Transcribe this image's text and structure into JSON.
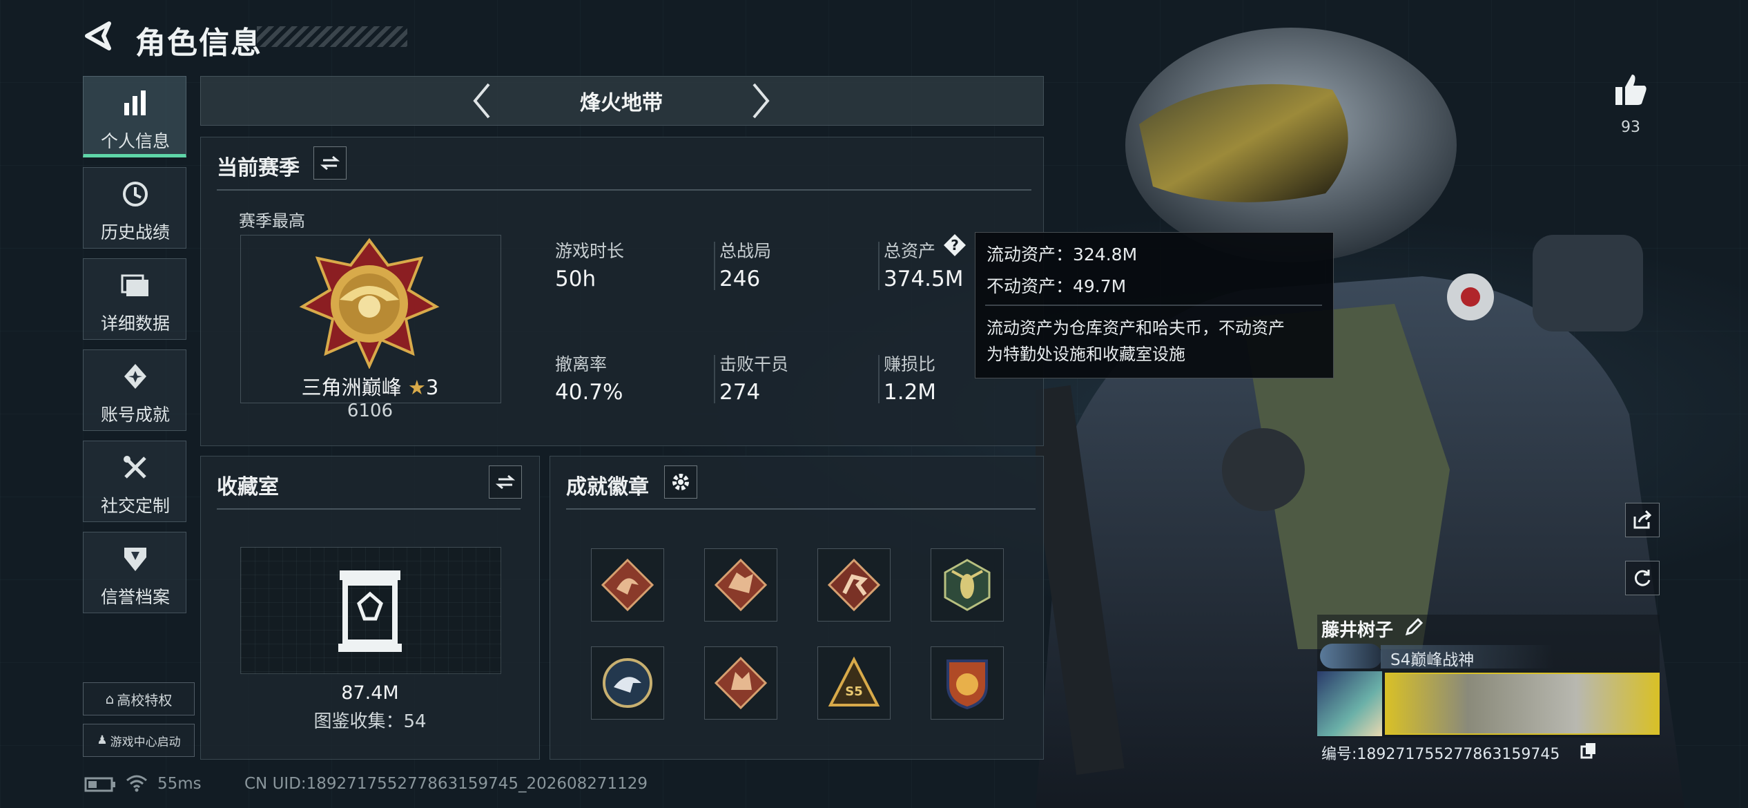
{
  "header": {
    "title": "角色信息"
  },
  "sidebar": {
    "items": [
      {
        "label": "个人信息",
        "icon": "bar-chart-icon"
      },
      {
        "label": "历史战绩",
        "icon": "clock-icon"
      },
      {
        "label": "详细数据",
        "icon": "folder-icon"
      },
      {
        "label": "账号成就",
        "icon": "achievement-icon"
      },
      {
        "label": "社交定制",
        "icon": "tools-icon"
      },
      {
        "label": "信誉档案",
        "icon": "shield-icon"
      }
    ],
    "campus_label": "高校特权",
    "game_center_label": "游戏中心启动"
  },
  "mode": {
    "title": "烽火地带"
  },
  "season": {
    "title": "当前赛季",
    "best_label": "赛季最高",
    "rank_name": "三角洲巅峰",
    "rank_star": "★",
    "rank_stars": "3",
    "rank_score": "6106",
    "stats": [
      {
        "label": "游戏时长",
        "value": "50h"
      },
      {
        "label": "总战局",
        "value": "246"
      },
      {
        "label": "总资产",
        "value": "374.5M"
      },
      {
        "label": "撤离率",
        "value": "40.7%"
      },
      {
        "label": "击败干员",
        "value": "274"
      },
      {
        "label": "赚损比",
        "value": "1.2M"
      }
    ]
  },
  "tooltip": {
    "liquid": "流动资产：324.8M",
    "fixed": "不动资产：49.7M",
    "desc1": "流动资产为仓库资产和哈夫币，不动资产",
    "desc2": "为特勤处设施和收藏室设施"
  },
  "collection": {
    "title": "收藏室",
    "value": "87.4M",
    "count_label": "图鉴收集：54"
  },
  "achievements": {
    "title": "成就徽章",
    "badges": [
      "dragon-badge-icon",
      "wolf-badge-icon",
      "runner-badge-icon",
      "wasp-badge-icon",
      "eagle-badge-icon",
      "beast-badge-icon",
      "s5-badge-icon",
      "medal-badge-icon"
    ]
  },
  "profile": {
    "likes": "93",
    "name": "藤井树子",
    "title_badge": "S4巅峰战神",
    "id_label": "编号:18927175527786315974​5"
  },
  "status": {
    "ping": "55ms",
    "uid": "CN UID:18927175527786315974​5_202608271129"
  },
  "colors": {
    "accent": "#5fd6a8",
    "rank_gold": "#d8aa4a"
  }
}
